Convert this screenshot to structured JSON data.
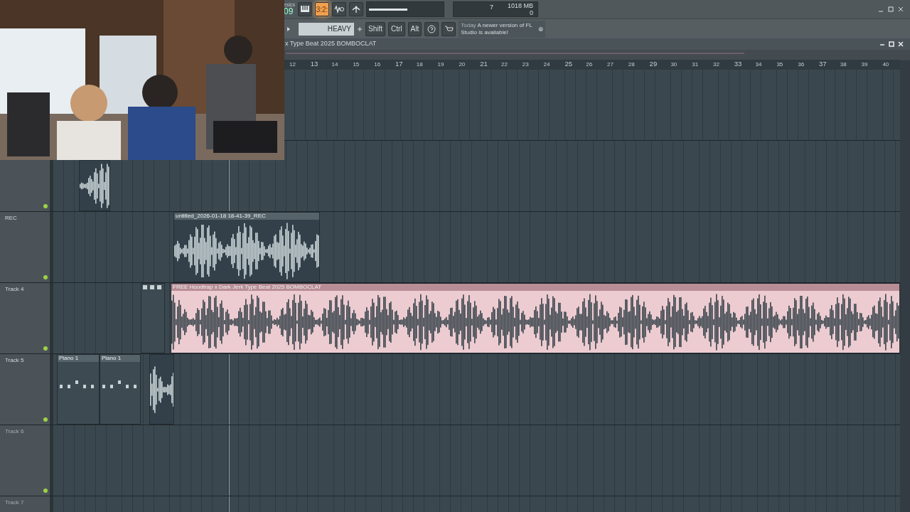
{
  "toolbar": {
    "hint_fragment": "esics",
    "counter": "09",
    "buttons": [
      {
        "kind": "piano",
        "selected": false
      },
      {
        "kind": "text",
        "label": "3:2:",
        "selected": true
      },
      {
        "kind": "wave",
        "selected": false
      },
      {
        "kind": "antenna",
        "selected": false
      }
    ],
    "tempo": {
      "level": 0.52
    },
    "cpu": "7",
    "memory": "1018 MB",
    "polyphony": "0",
    "pattern": "HEAVY",
    "keys": [
      "Shift",
      "Ctrl",
      "Alt"
    ],
    "news": {
      "prefix": "Today",
      "text": "A newer version of FL Studio is available!"
    }
  },
  "playlist": {
    "title": "x Type Beat 2025 BOMBOCLAT",
    "ruler": [
      "12",
      "13",
      "14",
      "15",
      "16",
      "17",
      "18",
      "19",
      "20",
      "21",
      "22",
      "23",
      "24",
      "25",
      "26",
      "27",
      "28",
      "29",
      "30",
      "31",
      "32",
      "33",
      "34",
      "35",
      "36",
      "37",
      "38",
      "39",
      "40"
    ],
    "tracks": [
      {
        "kind": "hidden"
      },
      {
        "kind": "hidden",
        "clips": [
          {
            "kind": "audio",
            "color": "#c8d3d6"
          }
        ]
      },
      {
        "kind": "track",
        "name": "REC",
        "dimmed": false,
        "clips": [
          {
            "kind": "audio",
            "label": "untitled_2026-01-18 18-41-39_REC",
            "color": "#c8d3d6"
          }
        ]
      },
      {
        "kind": "track",
        "name": "Track 4",
        "dimmed": false,
        "clips": [
          {
            "kind": "stub",
            "color": "#3d4a52"
          },
          {
            "kind": "audio",
            "label": "FREE Hoodtrap x Dark Jerk Type Beat 2025 BOMBOCLAT",
            "color": "#ecccd1"
          }
        ]
      },
      {
        "kind": "track",
        "name": "Track 5",
        "dimmed": false,
        "clips": [
          {
            "kind": "pattern",
            "label": "Piano 1",
            "color": "#3d4a52"
          },
          {
            "kind": "pattern",
            "label": "Piano 1",
            "color": "#3d4a52"
          },
          {
            "kind": "audio",
            "color": "#c8d3d6"
          }
        ]
      },
      {
        "kind": "track",
        "name": "Track 6",
        "dimmed": true
      },
      {
        "kind": "track",
        "name": "Track 7",
        "dimmed": true
      }
    ]
  }
}
